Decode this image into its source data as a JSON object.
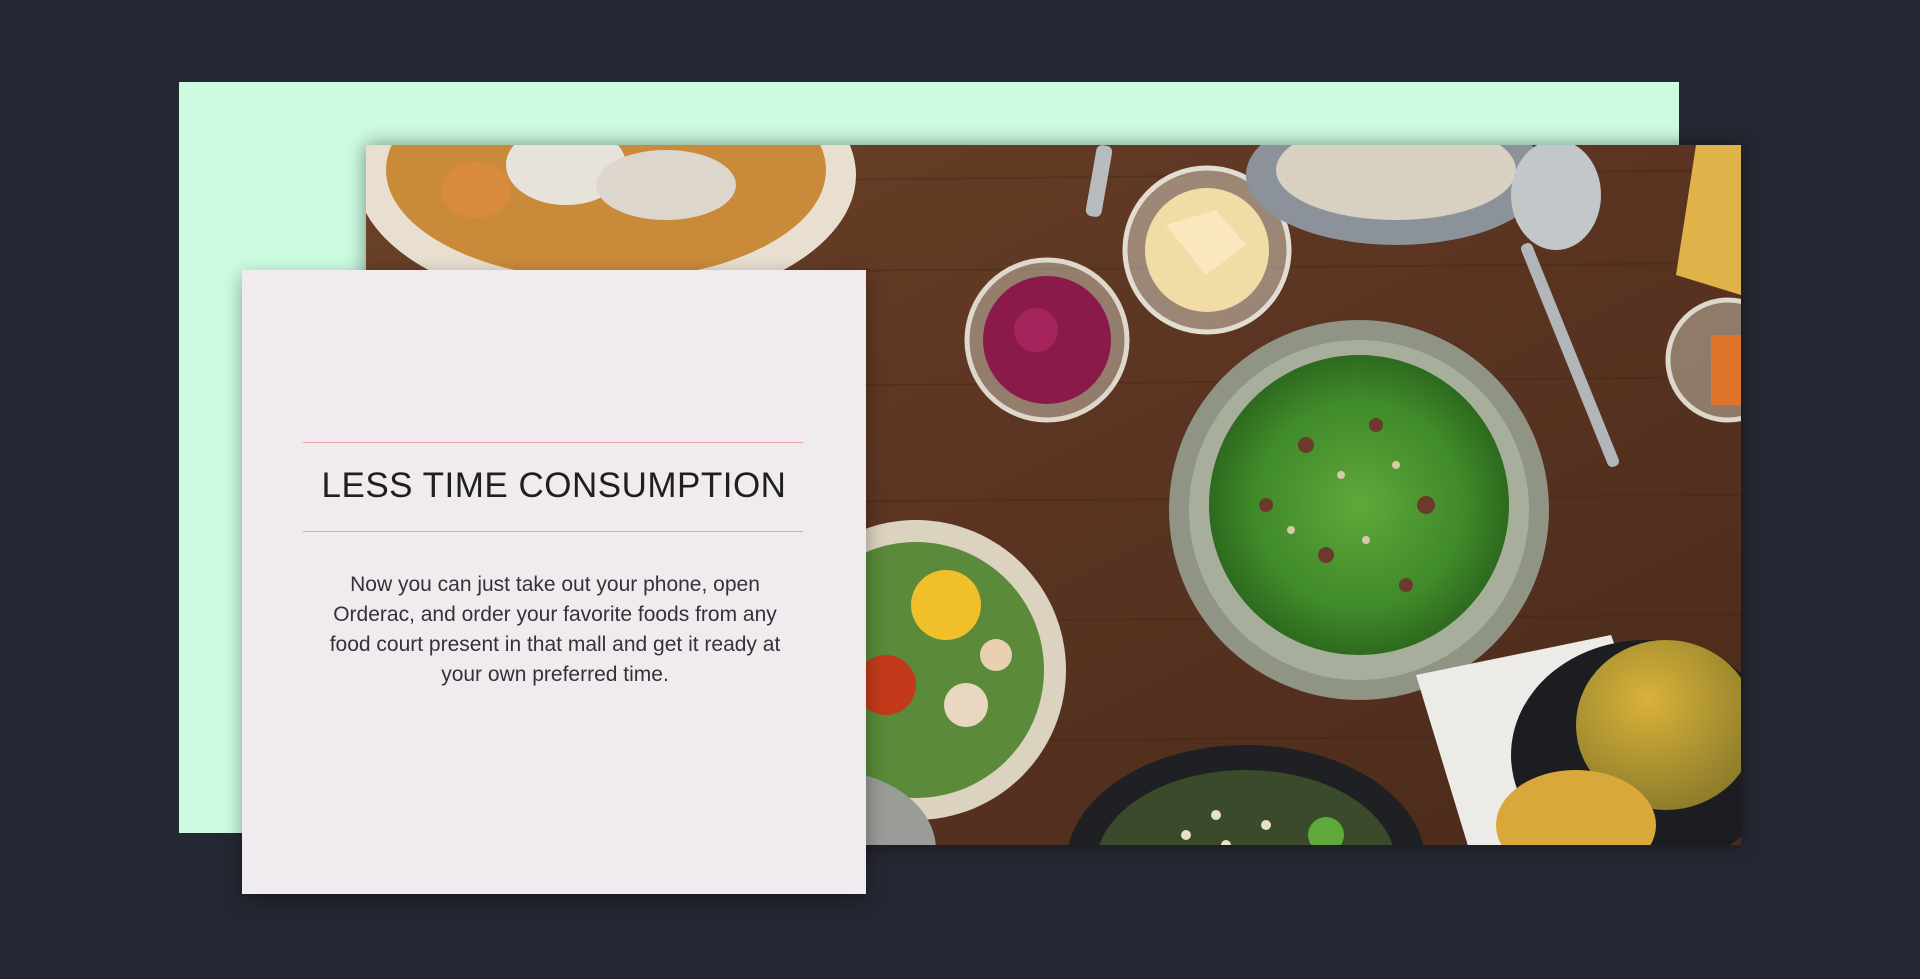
{
  "feature": {
    "title": "LESS TIME CONSUMPTION",
    "body": "Now you can just take out your phone, open Orderac, and order your favorite foods from any food court present in that mall and get it ready at your own preferred time."
  },
  "colors": {
    "background": "#252733",
    "mint_panel": "#ccfbe2",
    "card": "#f0ebef",
    "accent_rule": "#eaa6a1"
  },
  "image": {
    "subject": "overhead view of salads, bowls and jars on a wooden table"
  }
}
